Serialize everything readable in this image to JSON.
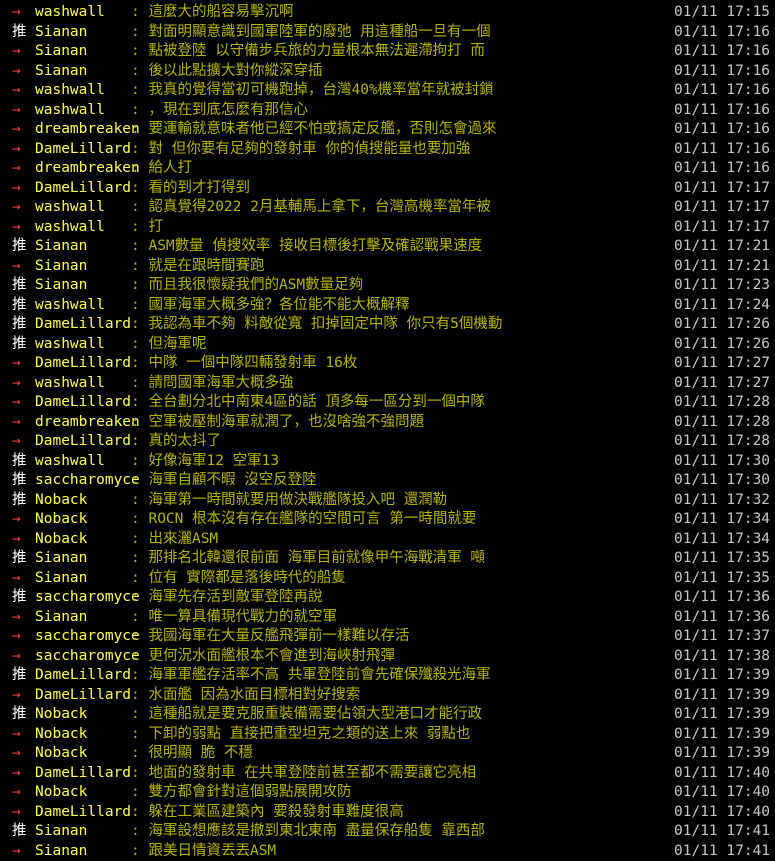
{
  "colors": {
    "arrow": "#ff3b3b",
    "push": "#ffffff",
    "user": "#ffff55",
    "message": "#b5b500",
    "time": "#c8c8c8",
    "background": "#000000"
  },
  "comments": [
    {
      "tag": "→",
      "type": "arrow",
      "user": "washwall",
      "msg": ": 這麼大的船容易擊沉啊",
      "time": "01/11 17:15"
    },
    {
      "tag": "推",
      "type": "push",
      "user": "Sianan",
      "msg": ": 對面明顯意識到國軍陸軍的廢弛 用這種船一旦有一個",
      "time": "01/11 17:16"
    },
    {
      "tag": "→",
      "type": "arrow",
      "user": "Sianan",
      "msg": ": 點被登陸 以守備步兵旅的力量根本無法遲滯拘打 而",
      "time": "01/11 17:16"
    },
    {
      "tag": "→",
      "type": "arrow",
      "user": "Sianan",
      "msg": ": 後以此點擴大對你縱深穿插",
      "time": "01/11 17:16"
    },
    {
      "tag": "→",
      "type": "arrow",
      "user": "washwall",
      "msg": ": 我真的覺得當初可機跑掉，台灣40%機率當年就被封鎖",
      "time": "01/11 17:16"
    },
    {
      "tag": "→",
      "type": "arrow",
      "user": "washwall",
      "msg": ": ，現在到底怎麼有那信心",
      "time": "01/11 17:16"
    },
    {
      "tag": "→",
      "type": "arrow",
      "user": "dreambreaken",
      "msg": ": 要運輸就意味者他已經不怕或搞定反艦，否則怎會過來",
      "time": "01/11 17:16"
    },
    {
      "tag": "→",
      "type": "arrow",
      "user": "DameLillard",
      "msg": ": 對 但你要有足夠的發射車 你的偵搜能量也要加強",
      "time": "01/11 17:16"
    },
    {
      "tag": "→",
      "type": "arrow",
      "user": "dreambreaken",
      "msg": ": 給人打",
      "time": "01/11 17:16"
    },
    {
      "tag": "→",
      "type": "arrow",
      "user": "DameLillard",
      "msg": ": 看的到才打得到",
      "time": "01/11 17:17"
    },
    {
      "tag": "→",
      "type": "arrow",
      "user": "washwall",
      "msg": ": 認真覺得2022 2月基輔馬上拿下，台灣高機率當年被",
      "time": "01/11 17:17"
    },
    {
      "tag": "→",
      "type": "arrow",
      "user": "washwall",
      "msg": ": 打",
      "time": "01/11 17:17"
    },
    {
      "tag": "推",
      "type": "push",
      "user": "Sianan",
      "msg": ": ASM數量 偵搜效率 接收目標後打擊及確認戰果速度",
      "time": "01/11 17:21"
    },
    {
      "tag": "→",
      "type": "arrow",
      "user": "Sianan",
      "msg": ": 就是在跟時間賽跑",
      "time": "01/11 17:21"
    },
    {
      "tag": "推",
      "type": "push",
      "user": "Sianan",
      "msg": ": 而且我很懷疑我們的ASM數量足夠",
      "time": "01/11 17:23"
    },
    {
      "tag": "推",
      "type": "push",
      "user": "washwall",
      "msg": ": 國軍海軍大概多強？各位能不能大概解釋",
      "time": "01/11 17:24"
    },
    {
      "tag": "推",
      "type": "push",
      "user": "DameLillard",
      "msg": ": 我認為車不夠 料敵從寬 扣掉固定中隊 你只有5個機動",
      "time": "01/11 17:26"
    },
    {
      "tag": "推",
      "type": "push",
      "user": "washwall",
      "msg": ": 但海軍呢",
      "time": "01/11 17:26"
    },
    {
      "tag": "→",
      "type": "arrow",
      "user": "DameLillard",
      "msg": ": 中隊 一個中隊四輛發射車 16枚",
      "time": "01/11 17:27"
    },
    {
      "tag": "→",
      "type": "arrow",
      "user": "washwall",
      "msg": ": 請問國軍海軍大概多強",
      "time": "01/11 17:27"
    },
    {
      "tag": "→",
      "type": "arrow",
      "user": "DameLillard",
      "msg": ": 全台劃分北中南東4區的話 頂多每一區分到一個中隊",
      "time": "01/11 17:28"
    },
    {
      "tag": "→",
      "type": "arrow",
      "user": "dreambreaken",
      "msg": ": 空軍被壓制海軍就潤了，也沒啥強不強問題",
      "time": "01/11 17:28"
    },
    {
      "tag": "→",
      "type": "arrow",
      "user": "DameLillard",
      "msg": ": 真的太抖了",
      "time": "01/11 17:28"
    },
    {
      "tag": "推",
      "type": "push",
      "user": "washwall",
      "msg": ": 好像海軍12 空軍13",
      "time": "01/11 17:30"
    },
    {
      "tag": "推",
      "type": "push",
      "user": "saccharomyce",
      "msg": ": 海軍自顧不暇 沒空反登陸",
      "time": "01/11 17:30"
    },
    {
      "tag": "推",
      "type": "push",
      "user": "Noback",
      "msg": ": 海軍第一時間就要用做決戰艦隊投入吧   還潤勒",
      "time": "01/11 17:32"
    },
    {
      "tag": "→",
      "type": "arrow",
      "user": "Noback",
      "msg": ": ROCN 根本沒有存在艦隊的空間可言   第一時間就要",
      "time": "01/11 17:34"
    },
    {
      "tag": "→",
      "type": "arrow",
      "user": "Noback",
      "msg": ": 出來灑ASM",
      "time": "01/11 17:34"
    },
    {
      "tag": "推",
      "type": "push",
      "user": "Sianan",
      "msg": ": 那排名北韓還很前面 海軍目前就像甲午海戰清軍 噸",
      "time": "01/11 17:35"
    },
    {
      "tag": "→",
      "type": "arrow",
      "user": "Sianan",
      "msg": ": 位有 實際都是落後時代的船隻",
      "time": "01/11 17:35"
    },
    {
      "tag": "推",
      "type": "push",
      "user": "saccharomyce",
      "msg": ": 海軍先存活到敵軍登陸再說",
      "time": "01/11 17:36"
    },
    {
      "tag": "→",
      "type": "arrow",
      "user": "Sianan",
      "msg": ": 唯一算具備現代戰力的就空軍",
      "time": "01/11 17:36"
    },
    {
      "tag": "→",
      "type": "arrow",
      "user": "saccharomyce",
      "msg": ": 我國海軍在大量反艦飛彈前一樣難以存活",
      "time": "01/11 17:37"
    },
    {
      "tag": "→",
      "type": "arrow",
      "user": "saccharomyce",
      "msg": ": 更何況水面艦根本不會進到海峽射飛彈",
      "time": "01/11 17:38"
    },
    {
      "tag": "推",
      "type": "push",
      "user": "DameLillard",
      "msg": ": 海軍軍艦存活率不高 共軍登陸前會先確保殲殺光海軍",
      "time": "01/11 17:39"
    },
    {
      "tag": "→",
      "type": "arrow",
      "user": "DameLillard",
      "msg": ": 水面艦 因為水面目標相對好搜索",
      "time": "01/11 17:39"
    },
    {
      "tag": "推",
      "type": "push",
      "user": "Noback",
      "msg": ": 這種船就是要克服重裝備需要佔領大型港口才能行政",
      "time": "01/11 17:39"
    },
    {
      "tag": "→",
      "type": "arrow",
      "user": "Noback",
      "msg": ": 下卸的弱點  直接把重型坦克之類的送上來   弱點也",
      "time": "01/11 17:39"
    },
    {
      "tag": "→",
      "type": "arrow",
      "user": "Noback",
      "msg": ": 很明顯   脆  不穩",
      "time": "01/11 17:39"
    },
    {
      "tag": "→",
      "type": "arrow",
      "user": "DameLillard",
      "msg": ": 地面的發射車 在共軍登陸前甚至都不需要讓它亮相",
      "time": "01/11 17:40"
    },
    {
      "tag": "→",
      "type": "arrow",
      "user": "Noback",
      "msg": ": 雙方都會針對這個弱點展開攻防",
      "time": "01/11 17:40"
    },
    {
      "tag": "→",
      "type": "arrow",
      "user": "DameLillard",
      "msg": ": 躲在工業區建築內 要殺發射車難度很高",
      "time": "01/11 17:40"
    },
    {
      "tag": "推",
      "type": "push",
      "user": "Sianan",
      "msg": ": 海軍設想應該是撤到東北東南 盡量保存船隻 靠西部",
      "time": "01/11 17:41"
    },
    {
      "tag": "→",
      "type": "arrow",
      "user": "Sianan",
      "msg": ": 跟美日情資丟丟ASM",
      "time": "01/11 17:41"
    }
  ]
}
